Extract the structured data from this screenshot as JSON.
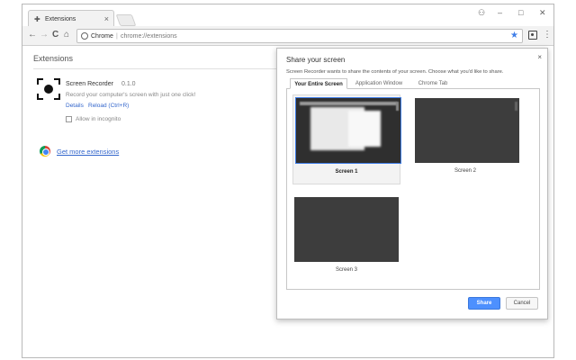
{
  "browser": {
    "tab": {
      "title": "Extensions",
      "icon": "puzzle-icon",
      "close_glyph": "×"
    },
    "window_controls": {
      "user": "⚇",
      "minimize": "–",
      "maximize": "□",
      "close": "✕"
    },
    "nav": {
      "back": "←",
      "forward": "→",
      "reload": "C",
      "home": "⌂"
    },
    "omnibox": {
      "secure_label": "Chrome",
      "separator": "|",
      "url": "chrome://extensions",
      "star": "★"
    },
    "menu_glyph": "⋮",
    "accent_color": "#3f7ee8"
  },
  "page": {
    "title": "Extensions",
    "extension": {
      "name": "Screen Recorder",
      "version": "0.1.0",
      "description": "Record your computer's screen with just one click!",
      "details_link": "Details",
      "reload_link": "Reload (Ctrl+R)",
      "incognito_label": "Allow in incognito",
      "incognito_checked": false
    },
    "more_extensions_link": "Get more extensions"
  },
  "dialog": {
    "title": "Share your screen",
    "close_glyph": "×",
    "description": "Screen Recorder wants to share the contents of your screen. Choose what you'd like to share.",
    "tabs": [
      {
        "label": "Your Entire Screen",
        "active": true
      },
      {
        "label": "Application Window",
        "active": false
      },
      {
        "label": "Chrome Tab",
        "active": false
      }
    ],
    "screens": [
      {
        "label": "Screen 1",
        "selected": true
      },
      {
        "label": "Screen 2",
        "selected": false
      },
      {
        "label": "Screen 3",
        "selected": false
      }
    ],
    "share_button": "Share",
    "cancel_button": "Cancel",
    "share_color": "#4d90fe"
  }
}
